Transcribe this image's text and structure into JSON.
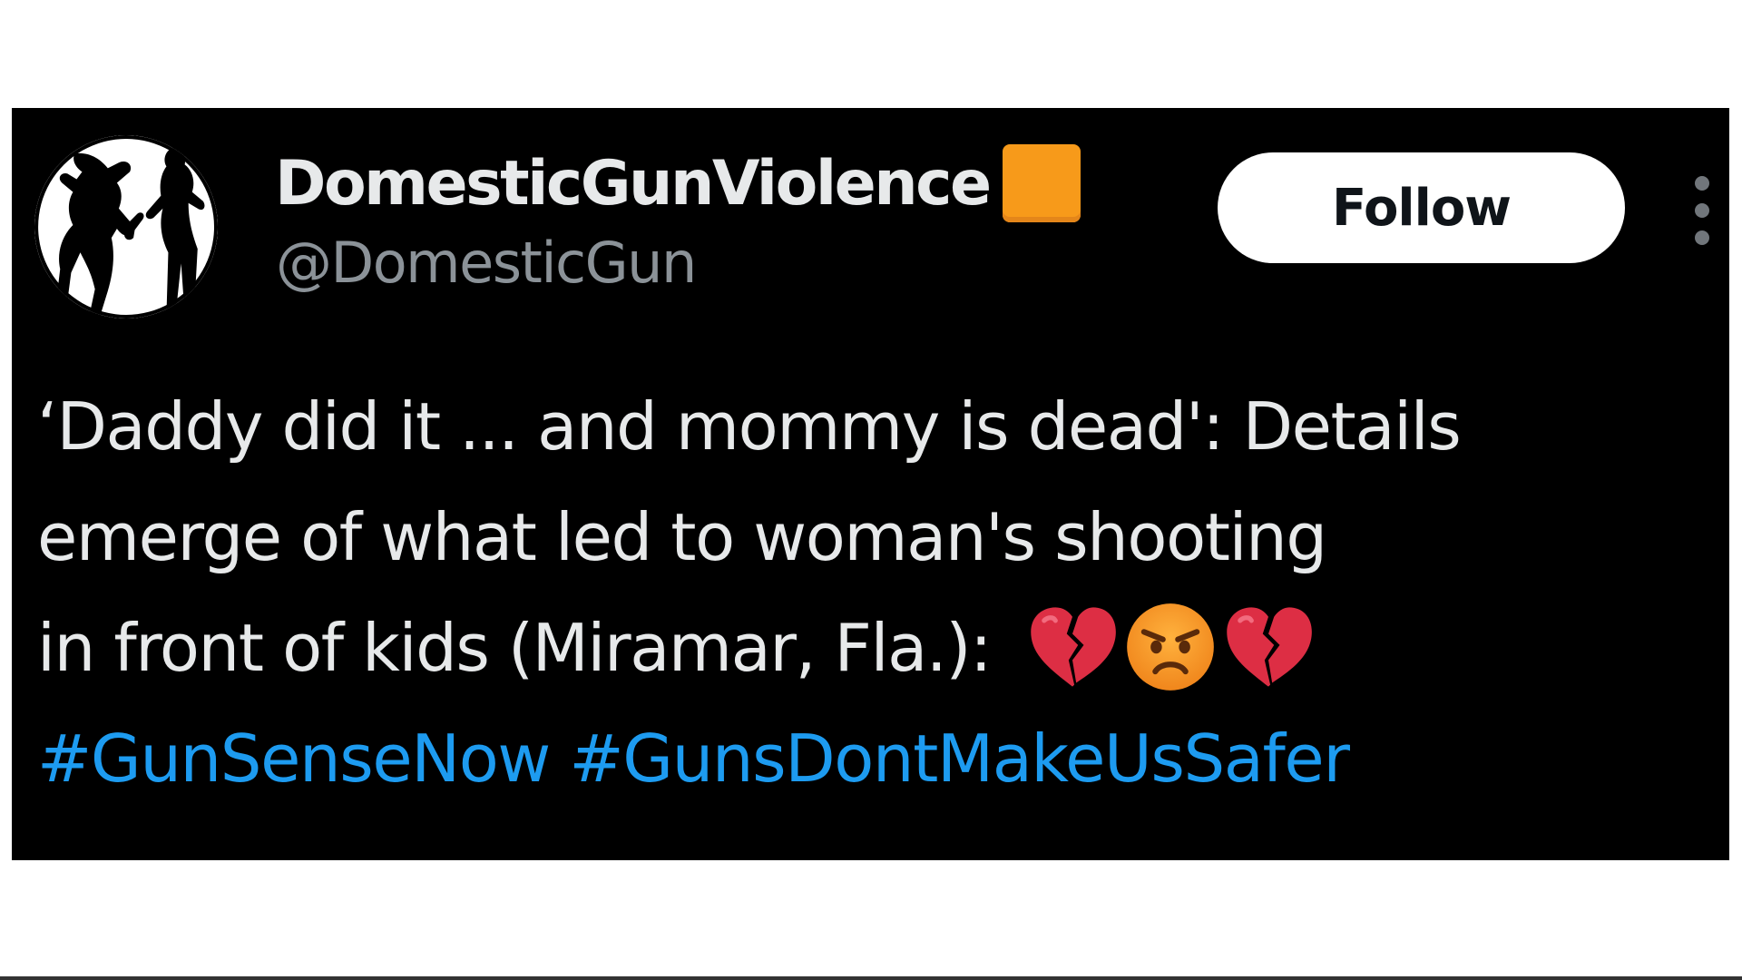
{
  "account": {
    "display_name": "DomesticGunViolence",
    "handle": "@DomesticGun",
    "badge_icon": "orange-square-icon",
    "badge_color": "#f79a1a"
  },
  "actions": {
    "follow_label": "Follow",
    "more_icon": "vertical-ellipsis-icon"
  },
  "tweet": {
    "lines": [
      "‘Daddy did it ... and mommy is dead': Details",
      "emerge of what led to woman's shooting",
      "in front of kids (Miramar, Fla.):"
    ],
    "emojis": [
      "broken-heart-icon",
      "angry-face-icon",
      "broken-heart-icon"
    ],
    "hashtags": [
      "#GunSenseNow",
      "#GunsDontMakeUsSafer"
    ]
  },
  "colors": {
    "card_background": "#000000",
    "text": "#e7e9ea",
    "secondary_text": "#8b9298",
    "link": "#1d9bf0",
    "button_background": "#ffffff"
  }
}
